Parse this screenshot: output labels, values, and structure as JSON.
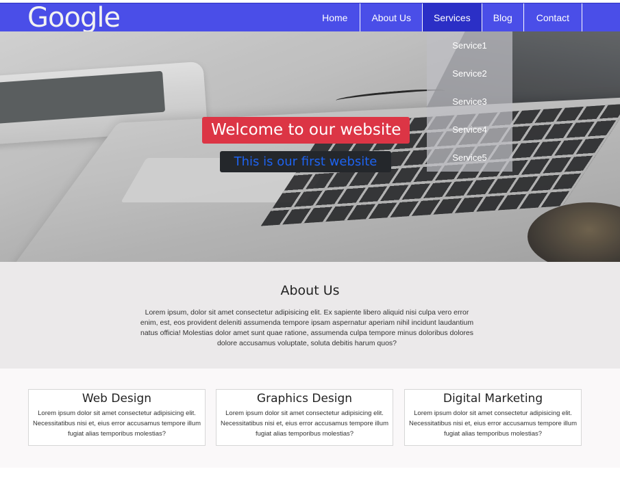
{
  "navbar": {
    "logo": "Google",
    "items": [
      {
        "label": "Home"
      },
      {
        "label": "About Us"
      },
      {
        "label": "Services"
      },
      {
        "label": "Blog"
      },
      {
        "label": "Contact"
      }
    ],
    "active": "Services"
  },
  "dropdown": {
    "items": [
      {
        "label": "Service1"
      },
      {
        "label": "Service2"
      },
      {
        "label": "Service3"
      },
      {
        "label": "Service4"
      },
      {
        "label": "Service5"
      }
    ]
  },
  "hero": {
    "title": "Welcome to our website",
    "subtitle": "This is our first website"
  },
  "about": {
    "heading": "About Us",
    "text": "Lorem ipsum, dolor sit amet consectetur adipisicing elit. Ex sapiente libero aliquid nisi culpa vero error enim, est, eos provident deleniti assumenda tempore ipsam aspernatur aperiam nihil incidunt laudantium natus officia! Molestias dolor amet sunt quae ratione, assumenda culpa tempore minus doloribus dolores dolore accusamus voluptate, soluta debitis harum quos?"
  },
  "services": {
    "cards": [
      {
        "title": "Web Design",
        "text": "Lorem ipsum dolor sit amet consectetur adipisicing elit. Necessitatibus nisi et, eius error accusamus tempore illum fugiat alias temporibus molestias?"
      },
      {
        "title": "Graphics Design",
        "text": "Lorem ipsum dolor sit amet consectetur adipisicing elit. Necessitatibus nisi et, eius error accusamus tempore illum fugiat alias temporibus molestias?"
      },
      {
        "title": "Digital Marketing",
        "text": "Lorem ipsum dolor sit amet consectetur adipisicing elit. Necessitatibus nisi et, eius error accusamus tempore illum fugiat alias temporibus molestias?"
      }
    ]
  },
  "colors": {
    "navbar": "#4a4ee8",
    "nav_active": "#2b2fc6",
    "hero_title_bg": "#dc3545",
    "hero_subtitle_bg": "#24272b",
    "hero_subtitle_text": "#1e63f0",
    "about_bg": "#ebe9ea"
  }
}
